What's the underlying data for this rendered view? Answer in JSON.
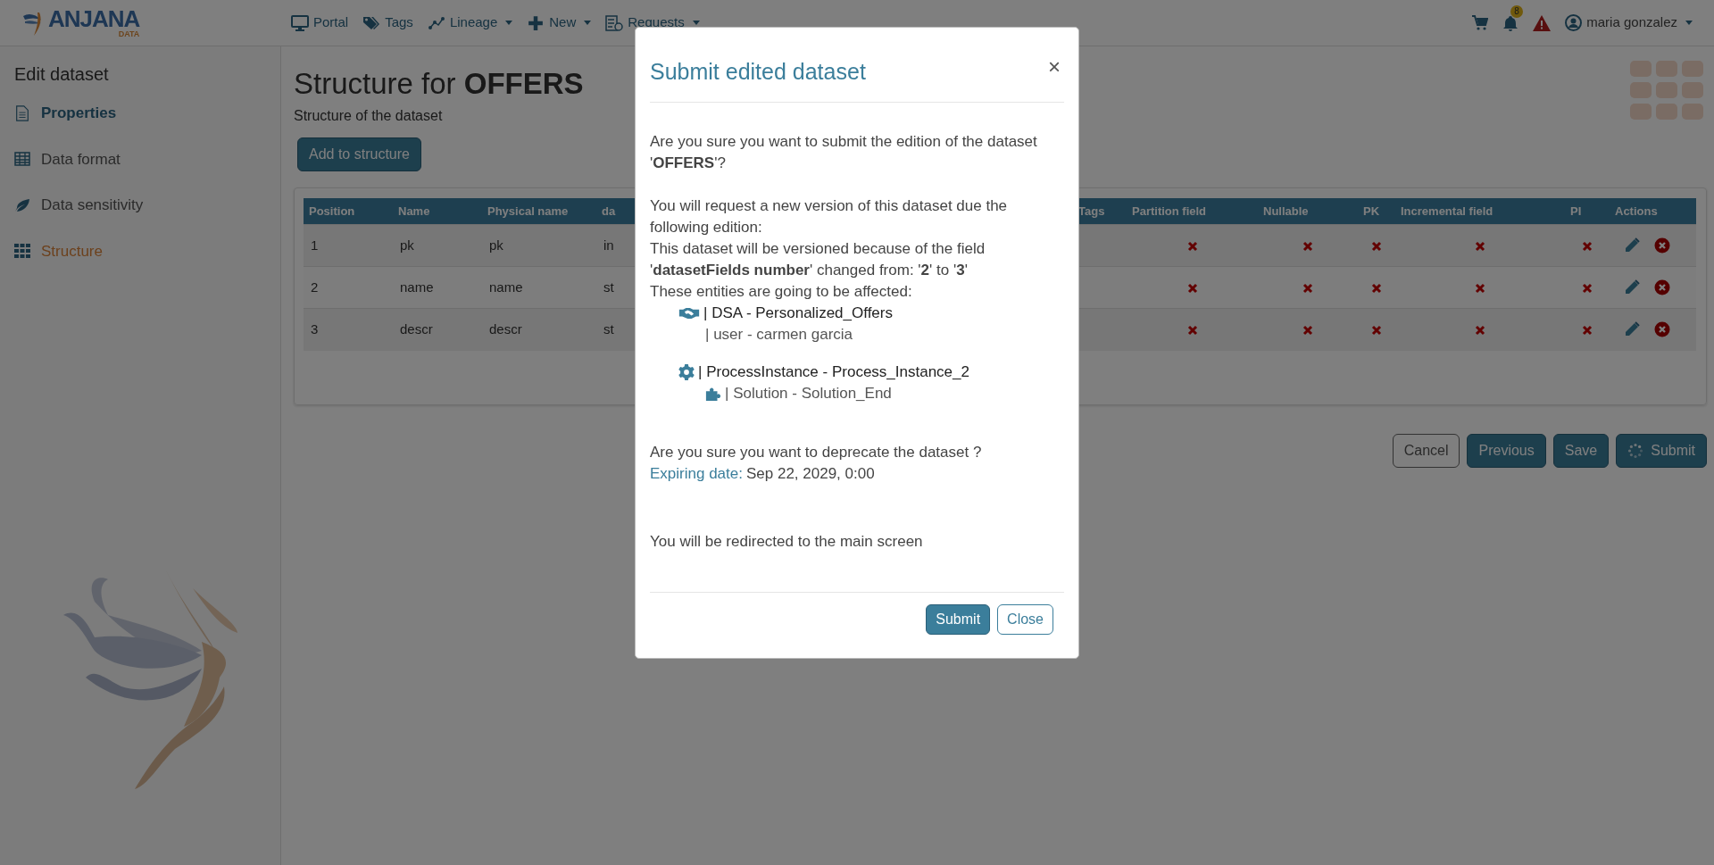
{
  "navbar": {
    "logo": {
      "name": "ANJANA",
      "sub": "DATA"
    },
    "menu": [
      {
        "label": "Portal",
        "kind": "monitor",
        "dropdown": false
      },
      {
        "label": "Tags",
        "kind": "tag",
        "dropdown": false
      },
      {
        "label": "Lineage",
        "kind": "lineage",
        "dropdown": true
      },
      {
        "label": "New",
        "kind": "plus",
        "dropdown": true
      },
      {
        "label": "Requests",
        "kind": "list",
        "dropdown": true
      }
    ],
    "notifications": "8",
    "user": "maria gonzalez"
  },
  "sidebar": {
    "title": "Edit dataset",
    "items": [
      {
        "label": "Properties",
        "kind": "document",
        "visited": true,
        "selected": false
      },
      {
        "label": "Data format",
        "kind": "table",
        "visited": false,
        "selected": false
      },
      {
        "label": "Data sensitivity",
        "kind": "leaf",
        "visited": false,
        "selected": false
      },
      {
        "label": "Structure",
        "kind": "grid",
        "visited": false,
        "selected": true
      }
    ]
  },
  "main": {
    "title": "Structure for **OFFERS**",
    "subtitle": "Structure of the dataset",
    "add_button": "Add to structure",
    "table": {
      "columns": [
        {
          "label": "Position",
          "kind": "text"
        },
        {
          "label": "Name",
          "kind": "text"
        },
        {
          "label": "Physical name",
          "kind": "text"
        },
        {
          "label": "da",
          "kind": "text"
        },
        {
          "label": "Tags",
          "kind": "tags"
        },
        {
          "label": "Partition field",
          "kind": "flag"
        },
        {
          "label": "Nullable",
          "kind": "flag"
        },
        {
          "label": "PK",
          "kind": "flag"
        },
        {
          "label": "Incremental field",
          "kind": "flag"
        },
        {
          "label": "PI",
          "kind": "flag"
        },
        {
          "label": "Actions",
          "kind": "actions"
        }
      ],
      "rows": [
        {
          "values": [
            "1",
            "pk",
            "pk",
            "in"
          ],
          "flags": [
            false,
            false,
            false,
            false,
            false
          ]
        },
        {
          "values": [
            "2",
            "name",
            "name",
            "st"
          ],
          "flags": [
            false,
            false,
            false,
            false,
            false
          ]
        },
        {
          "values": [
            "3",
            "descr",
            "descr",
            "st"
          ],
          "flags": [
            false,
            false,
            false,
            false,
            false
          ]
        }
      ]
    },
    "buttons": [
      {
        "label": "Cancel",
        "kind": "outline"
      },
      {
        "label": "Previous",
        "kind": "primary"
      },
      {
        "label": "Save",
        "kind": "primary"
      },
      {
        "label": "Submit",
        "kind": "spinner"
      }
    ]
  },
  "modal": {
    "title": "Submit edited dataset",
    "close": "×",
    "intro": "Are you sure you want to submit the edition of the dataset '**OFFERS**'?",
    "lines": [
      "You will request a new version of this dataset due the following edition:",
      "This dataset will be versioned because of the field '**datasetFields number**' changed from: '**2**' to '**3**'",
      "These entities are going to be affected:"
    ],
    "entities": [
      {
        "kind": "handshake",
        "text": "| DSA - Personalized_Offers",
        "children": [
          {
            "kind": "none",
            "text": "| user - carmen garcia"
          }
        ]
      },
      {
        "kind": "gear",
        "text": "| ProcessInstance - Process_Instance_2",
        "children": [
          {
            "kind": "puzzle",
            "text": "| Solution - Solution_End"
          }
        ]
      }
    ],
    "deprecate": {
      "question": "Are you sure you want to deprecate the dataset ?",
      "label": "Expiring date:",
      "value": "Sep 22, 2029, 0:00"
    },
    "redirect": "You will be redirected to the main screen",
    "buttons": [
      {
        "label": "Submit",
        "kind": "primary"
      },
      {
        "label": "Close",
        "kind": "outline"
      }
    ]
  }
}
